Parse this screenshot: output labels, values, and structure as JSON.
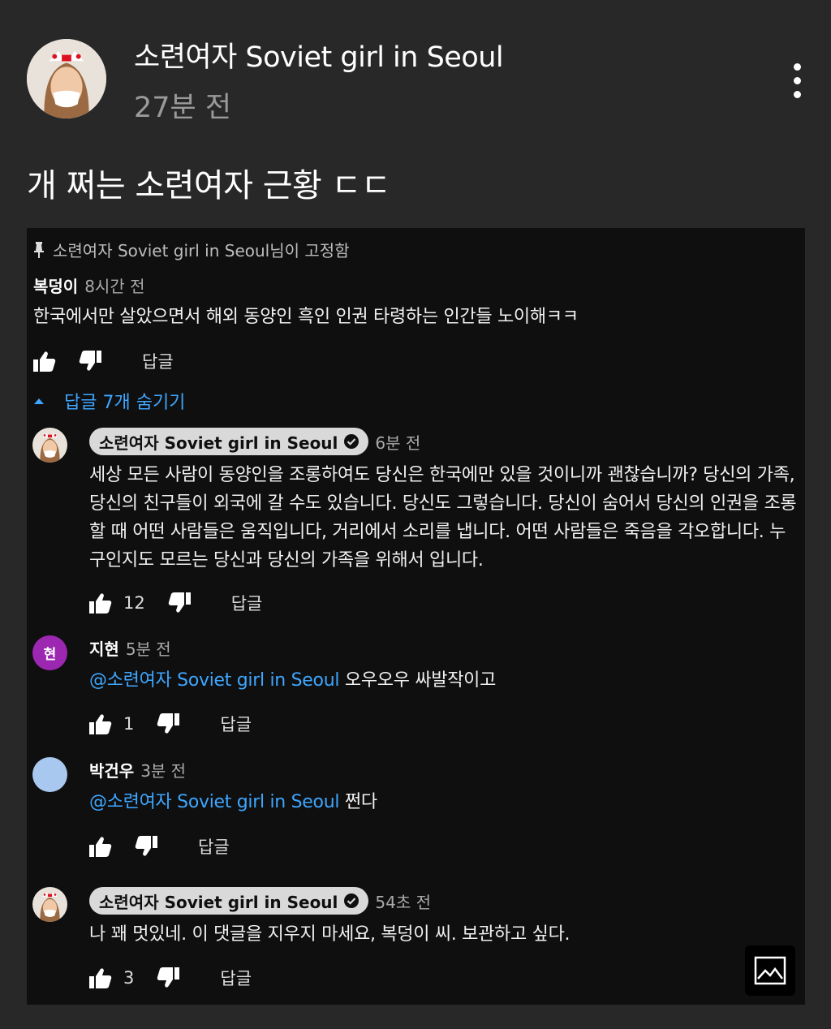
{
  "post": {
    "channel_name": "소련여자 Soviet girl in Seoul",
    "time": "27분 전",
    "text": "개 쩌는 소련여자 근황 ㄷㄷ"
  },
  "pinned_label": "소련여자 Soviet girl in Seoul님이 고정함",
  "top_comment": {
    "author": "복덩이",
    "time": "8시간 전",
    "text": "한국에서만 살았으면서 해외 동양인 흑인 인권 타령하는 인간들 노이해ㅋㅋ",
    "reply_label": "답글"
  },
  "replies_toggle": "답글 7개 숨기기",
  "replies": [
    {
      "author": "소련여자 Soviet girl in Seoul",
      "time": "6분 전",
      "text": "세상 모든 사람이 동양인을 조롱하여도 당신은 한국에만 있을 것이니까 괜찮습니까? 당신의 가족, 당신의 친구들이 외국에 갈 수도 있습니다. 당신도 그렇습니다. 당신이 숨어서 당신의 인권을 조롱할 때 어떤 사람들은 움직입니다, 거리에서 소리를 냅니다. 어떤 사람들은 죽음을 각오합니다. 누구인지도 모르는 당신과 당신의 가족을 위해서 입니다.",
      "likes": "12",
      "reply_label": "답글"
    },
    {
      "author": "지현",
      "avatar_letter": "현",
      "time": "5분 전",
      "mention": "@소련여자 Soviet girl in Seoul",
      "text": "오우오우 싸발작이고",
      "likes": "1",
      "reply_label": "답글"
    },
    {
      "author": "박건우",
      "time": "3분 전",
      "mention": "@소련여자 Soviet girl in Seoul",
      "text": "쩐다",
      "reply_label": "답글"
    },
    {
      "author": "소련여자 Soviet girl in Seoul",
      "time": "54초 전",
      "text": "나 꽤 멋있네. 이 댓글을 지우지 마세요, 복덩이 씨. 보관하고 싶다.",
      "likes": "3",
      "reply_label": "답글"
    }
  ],
  "colors": {
    "background": "#282828",
    "comment_panel": "#0f0f0f",
    "link": "#3ea6ff",
    "avatar_purple": "#9c27b0",
    "avatar_blue": "#a9c8f0"
  },
  "icons": [
    "more-vert-icon",
    "pin-icon",
    "thumb-up-icon",
    "thumb-down-icon",
    "caret-up-icon",
    "verified-icon",
    "image-icon"
  ]
}
